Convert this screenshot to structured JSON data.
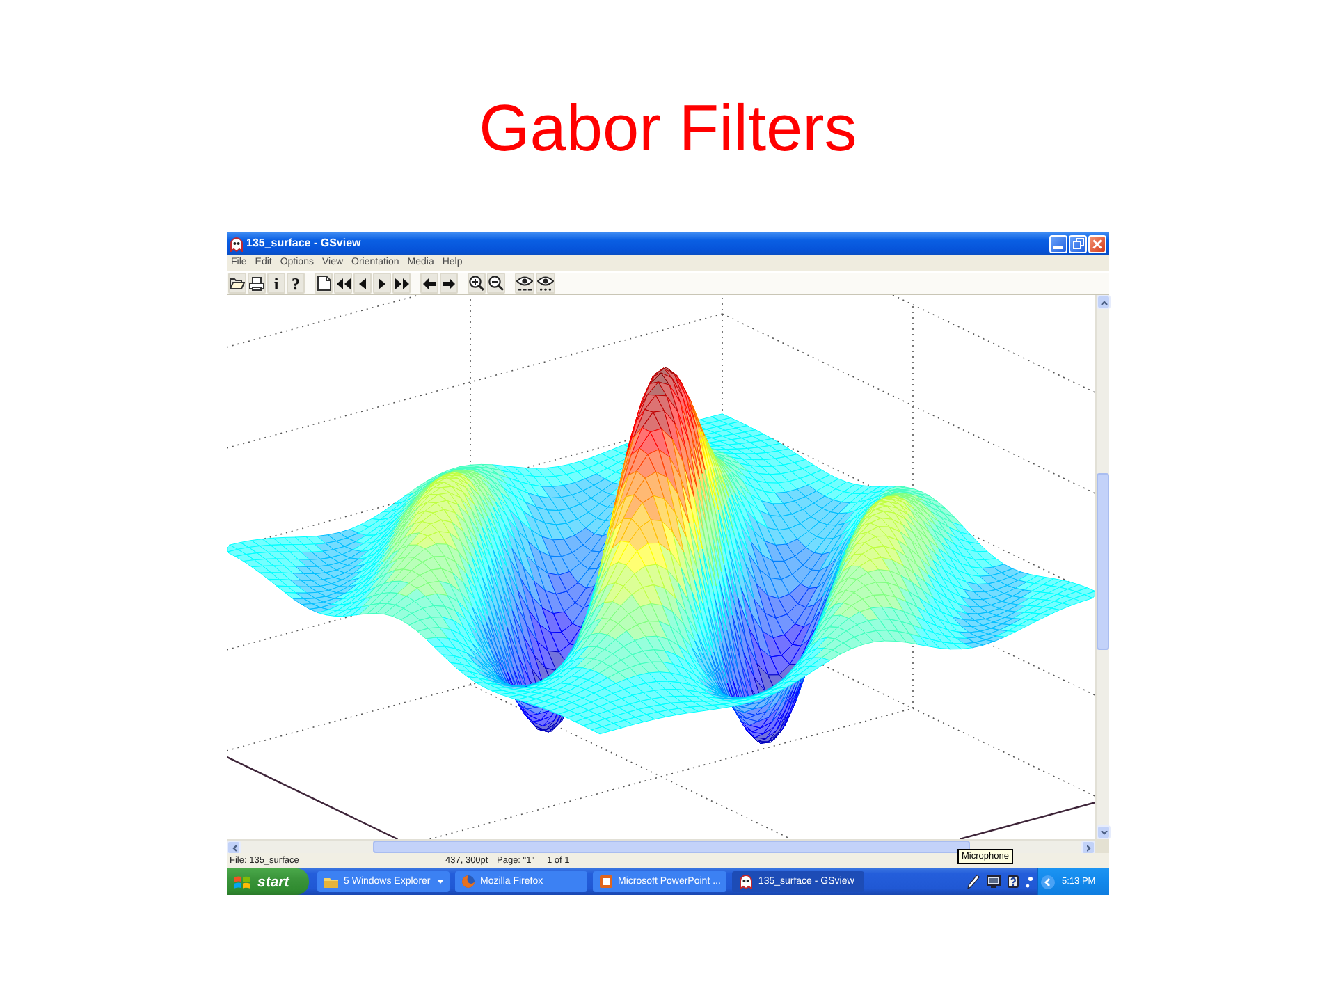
{
  "slide": {
    "title": "Gabor Filters"
  },
  "window": {
    "title": "135_surface - GSview"
  },
  "menu": [
    "File",
    "Edit",
    "Options",
    "View",
    "Orientation",
    "Media",
    "Help"
  ],
  "toolbar": {
    "glyphs": [
      "i",
      "?"
    ]
  },
  "status_bar": {
    "file": "File: 135_surface",
    "position": "437, 300pt",
    "page": "Page: \"1\"",
    "page_count": "1 of 1"
  },
  "tooltip": {
    "text": "Microphone"
  },
  "taskbar": {
    "start": "start",
    "tasks": [
      {
        "kind": "folder",
        "label": "5 Windows Explorer",
        "grouped": true,
        "selected": false
      },
      {
        "kind": "browser",
        "label": "Mozilla Firefox",
        "grouped": false,
        "selected": false
      },
      {
        "kind": "slides",
        "label": "Microsoft PowerPoint ...",
        "grouped": false,
        "selected": false
      },
      {
        "kind": "viewer",
        "label": "135_surface - GSview",
        "grouped": false,
        "selected": true
      }
    ],
    "clock": "5:13 PM"
  }
}
